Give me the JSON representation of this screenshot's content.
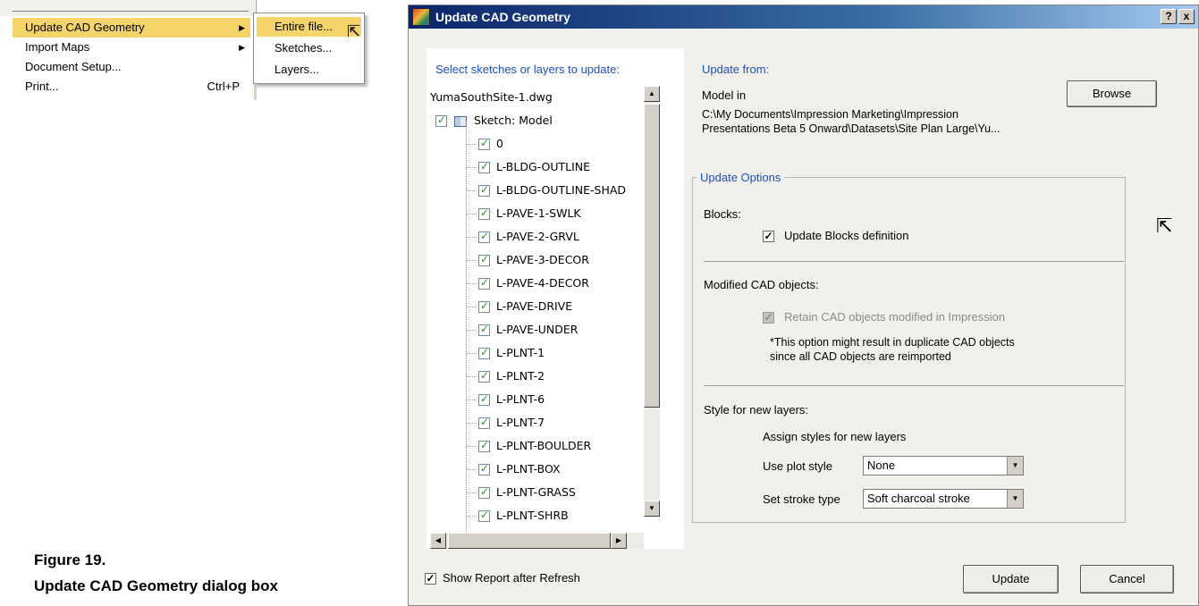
{
  "menu": {
    "items": [
      {
        "label": "Update CAD Geometry",
        "has_submenu": true,
        "selected": true
      },
      {
        "label": "Import Maps",
        "has_submenu": true
      },
      {
        "label": "Document Setup...",
        "has_submenu": false
      },
      {
        "label": "Print...",
        "accelerator": "Ctrl+P",
        "has_submenu": false
      }
    ],
    "submenu": [
      {
        "label": "Entire file...",
        "selected": true
      },
      {
        "label": "Sketches..."
      },
      {
        "label": "Layers..."
      }
    ]
  },
  "caption": {
    "line1": "Figure 19.",
    "line2": "Update CAD Geometry dialog box"
  },
  "dialog": {
    "title": "Update CAD Geometry",
    "help_label": "?",
    "close_label": "x",
    "left_panel": {
      "label": "Select sketches or layers to update:",
      "file_name": "YumaSouthSite-1.dwg",
      "sketch_label": "Sketch: Model",
      "layers": [
        "0",
        "L-BLDG-OUTLINE",
        "L-BLDG-OUTLINE-SHAD",
        "L-PAVE-1-SWLK",
        "L-PAVE-2-GRVL",
        "L-PAVE-3-DECOR",
        "L-PAVE-4-DECOR",
        "L-PAVE-DRIVE",
        "L-PAVE-UNDER",
        "L-PLNT-1",
        "L-PLNT-2",
        "L-PLNT-6",
        "L-PLNT-7",
        "L-PLNT-BOULDER",
        "L-PLNT-BOX",
        "L-PLNT-GRASS",
        "L-PLNT-SHRB"
      ]
    },
    "update_from": {
      "label": "Update from:",
      "model_in": "Model in",
      "browse_label": "Browse",
      "path_line1": "C:\\My Documents\\Impression Marketing\\Impression",
      "path_line2": "Presentations Beta 5 Onward\\Datasets\\Site Plan Large\\Yu..."
    },
    "options": {
      "legend": "Update Options",
      "blocks_label": "Blocks:",
      "update_blocks_label": "Update Blocks definition",
      "update_blocks_checked": true,
      "modified_label": "Modified CAD objects:",
      "retain_label": "Retain CAD objects modified in Impression",
      "retain_checked": true,
      "retain_disabled": true,
      "note_line1": "*This option might result in duplicate CAD objects",
      "note_line2": "since all CAD objects are reimported",
      "style_label": "Style for new layers:",
      "assign_label": "Assign styles for new layers",
      "plot_style_label": "Use plot style",
      "plot_style_value": "None",
      "stroke_type_label": "Set stroke type",
      "stroke_type_value": "Soft charcoal stroke"
    },
    "show_report_label": "Show Report after Refresh",
    "show_report_checked": true,
    "update_button": "Update",
    "cancel_button": "Cancel"
  }
}
